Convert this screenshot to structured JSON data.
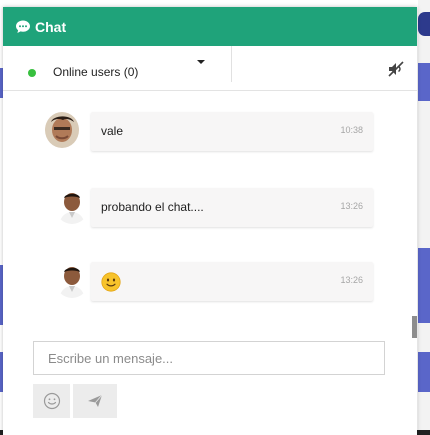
{
  "header": {
    "title": "Chat",
    "icon": "chat-bubble-icon",
    "color": "#1fa37a"
  },
  "users_bar": {
    "label": "Online users (0)",
    "status_color": "#38c03f",
    "mute_icon": "mute-icon"
  },
  "messages": [
    {
      "text": "vale",
      "time": "10:38"
    },
    {
      "text": "probando el chat....",
      "time": "13:26"
    },
    {
      "text": "",
      "emoji": "slightly-smiling-face",
      "time": "13:26"
    }
  ],
  "composer": {
    "placeholder": "Escribe un mensaje...",
    "emoji_button_icon": "smiley-icon",
    "send_button_icon": "paper-plane-icon"
  }
}
